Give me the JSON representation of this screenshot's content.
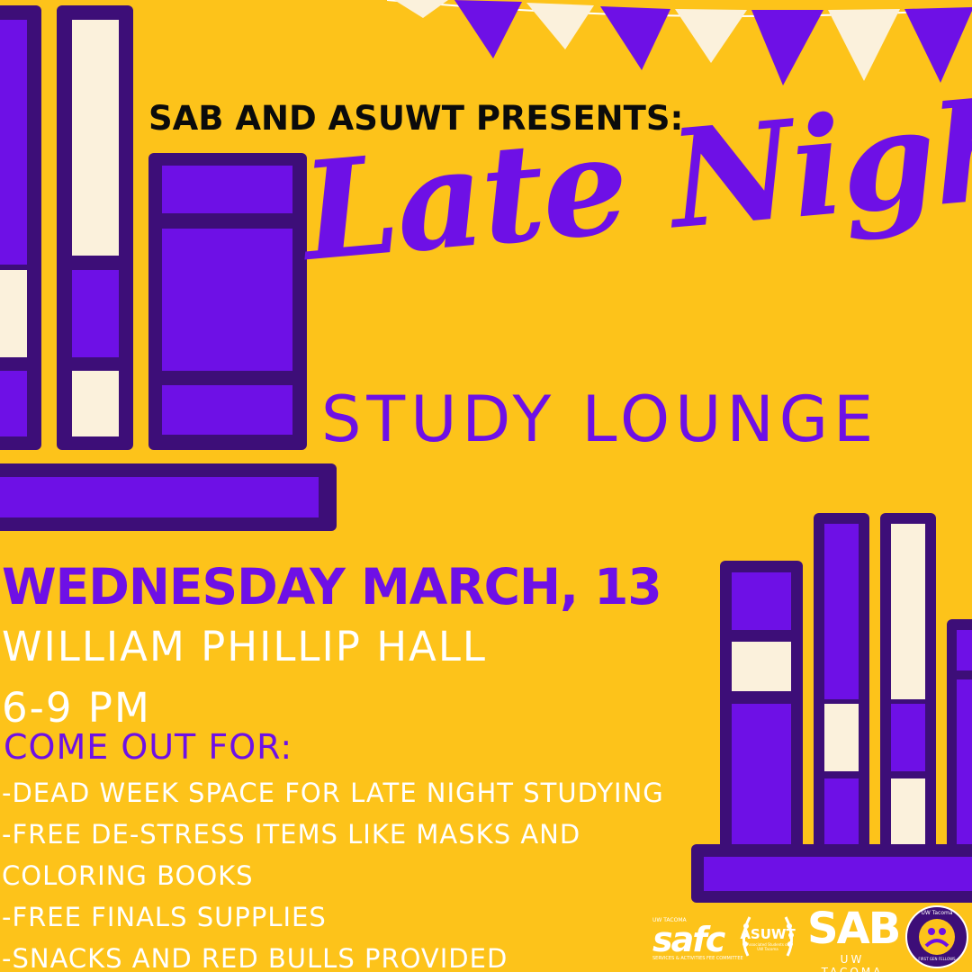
{
  "colors": {
    "background": "#fdc31a",
    "purple": "#6e10e6",
    "dark_purple": "#3d0e78",
    "cream": "#fbf1dc",
    "black": "#0b0b0b",
    "white": "#ffffff"
  },
  "header": {
    "presents": "SAB AND ASUWT PRESENTS:"
  },
  "title": {
    "script": "Late Night",
    "sub": "STUDY LOUNGE"
  },
  "event": {
    "date": "WEDNESDAY MARCH, 13",
    "location": "WILLIAM PHILLIP HALL",
    "time": "6-9 PM"
  },
  "offerings": {
    "heading": "COME OUT FOR:",
    "items": [
      "-DEAD WEEK SPACE FOR LATE NIGHT STUDYING",
      "-FREE DE-STRESS ITEMS LIKE MASKS AND",
      "COLORING BOOKS",
      "-FREE FINALS SUPPLIES",
      "-SNACKS AND RED BULLS PROVIDED"
    ]
  },
  "logos": {
    "safc": {
      "top": "UW TACOMA",
      "main": "safc",
      "bottom": "SERVICES & ACTIVITIES FEE COMMITTEE"
    },
    "asuwt": {
      "main": "ASUWT",
      "bottom": "Associated Students of UW Tacoma"
    },
    "sab": {
      "main": "SAB",
      "bottom": "UW TACOMA"
    },
    "fgf": {
      "top": "UW Tacoma",
      "bottom": "FIRST GEN FELLOWS"
    }
  }
}
